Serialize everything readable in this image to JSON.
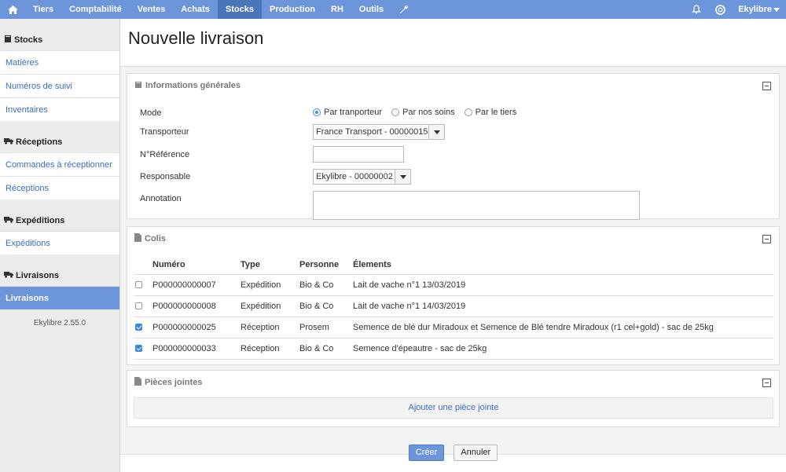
{
  "topnav": {
    "items": [
      "Tiers",
      "Comptabilité",
      "Ventes",
      "Achats",
      "Stocks",
      "Production",
      "RH",
      "Outils"
    ],
    "active": "Stocks",
    "user": "Ekylibre"
  },
  "sidebar": {
    "sections": [
      {
        "title": "Stocks",
        "links": [
          "Matières",
          "Numéros de suivi",
          "Inventaires"
        ]
      },
      {
        "title": "Réceptions",
        "links": [
          "Commandes à réceptionner",
          "Réceptions"
        ]
      },
      {
        "title": "Expéditions",
        "links": [
          "Expéditions"
        ]
      },
      {
        "title": "Livraisons",
        "links": [
          "Livraisons"
        ]
      }
    ],
    "version": "Ekylibre 2.55.0"
  },
  "page": {
    "title": "Nouvelle livraison"
  },
  "general": {
    "title": "Informations générales",
    "mode_label": "Mode",
    "mode_options": [
      "Par tranporteur",
      "Par nos soins",
      "Par le tiers"
    ],
    "mode_selected": "Par tranporteur",
    "transporteur_label": "Transporteur",
    "transporteur_value": "France Transport - 00000015",
    "reference_label": "N°Référence",
    "reference_value": "",
    "responsable_label": "Responsable",
    "responsable_value": "Ekylibre - 00000002",
    "annotation_label": "Annotation",
    "annotation_value": ""
  },
  "colis": {
    "title": "Colis",
    "columns": [
      "Numéro",
      "Type",
      "Personne",
      "Élements"
    ],
    "rows": [
      {
        "checked": false,
        "numero": "P000000000007",
        "type": "Expédition",
        "personne": "Bio & Co",
        "elements": "Lait de vache n°1 13/03/2019"
      },
      {
        "checked": false,
        "numero": "P000000000008",
        "type": "Expédition",
        "personne": "Bio & Co",
        "elements": "Lait de vache n°1 14/03/2019"
      },
      {
        "checked": true,
        "numero": "P000000000025",
        "type": "Réception",
        "personne": "Prosem",
        "elements": "Semence de blé dur Miradoux et Semence de Blé tendre Miradoux (r1 cel+gold) - sac de 25kg"
      },
      {
        "checked": true,
        "numero": "P000000000033",
        "type": "Réception",
        "personne": "Bio & Co",
        "elements": "Semence d'épeautre - sac de 25kg"
      }
    ]
  },
  "attachments": {
    "title": "Pièces jointes",
    "add_label": "Ajouter une pièce jointe"
  },
  "actions": {
    "create": "Créer",
    "cancel": "Annuler"
  },
  "colors": {
    "accent": "#6c96d9",
    "accent_dark": "#4b75b9",
    "link": "#3d6cc0"
  }
}
